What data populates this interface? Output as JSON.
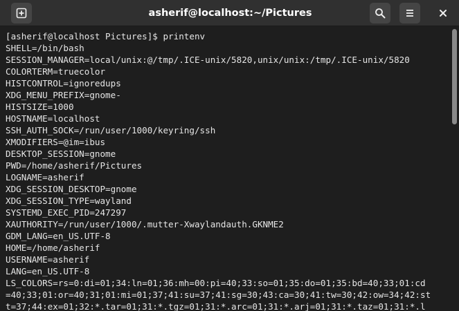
{
  "window": {
    "title": "asherif@localhost:~/Pictures"
  },
  "icons": {
    "new_tab": "new-tab-icon",
    "search": "search-icon",
    "menu": "hamburger-menu-icon",
    "close": "close-icon"
  },
  "colors": {
    "titlebar": "#303030",
    "terminal_background": "#1e1e1e",
    "terminal_text": "#e6e6e6",
    "scrollbar_thumb": "#8a8a8a"
  },
  "terminal": {
    "lines": [
      "[asherif@localhost Pictures]$ printenv",
      "SHELL=/bin/bash",
      "SESSION_MANAGER=local/unix:@/tmp/.ICE-unix/5820,unix/unix:/tmp/.ICE-unix/5820",
      "COLORTERM=truecolor",
      "HISTCONTROL=ignoredups",
      "XDG_MENU_PREFIX=gnome-",
      "HISTSIZE=1000",
      "HOSTNAME=localhost",
      "SSH_AUTH_SOCK=/run/user/1000/keyring/ssh",
      "XMODIFIERS=@im=ibus",
      "DESKTOP_SESSION=gnome",
      "PWD=/home/asherif/Pictures",
      "LOGNAME=asherif",
      "XDG_SESSION_DESKTOP=gnome",
      "XDG_SESSION_TYPE=wayland",
      "SYSTEMD_EXEC_PID=247297",
      "XAUTHORITY=/run/user/1000/.mutter-Xwaylandauth.GKNME2",
      "GDM_LANG=en_US.UTF-8",
      "HOME=/home/asherif",
      "USERNAME=asherif",
      "LANG=en_US.UTF-8",
      "LS_COLORS=rs=0:di=01;34:ln=01;36:mh=00:pi=40;33:so=01;35:do=01;35:bd=40;33;01:cd",
      "=40;33;01:or=40;31;01:mi=01;37;41:su=37;41:sg=30;43:ca=30;41:tw=30;42:ow=34;42:st",
      "t=37;44:ex=01;32:*.tar=01;31:*.tgz=01;31:*.arc=01;31:*.arj=01;31:*.taz=01;31:*.l"
    ]
  }
}
